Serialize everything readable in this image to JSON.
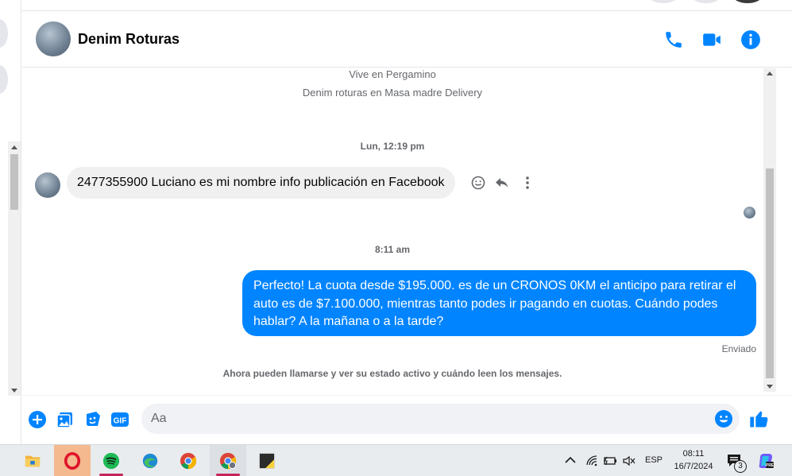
{
  "header": {
    "contact_name": "Denim Roturas"
  },
  "chat": {
    "intro_lines": [
      "Vive en Pergamino",
      "Denim roturas en Masa madre Delivery"
    ],
    "timestamp_1": "Lun, 12:19 pm",
    "incoming_message": "2477355900 Luciano es mi nombre info publicación en Facebook",
    "timestamp_2": "8:11 am",
    "outgoing_message": "Perfecto! La cuota desde $195.000. es de un CRONOS 0KM el anticipo para retirar el auto es de $7.100.000, mientras tanto podes ir pagando en cuotas. Cuándo podes hablar? A la mañana o a la tarde?",
    "sent_status": "Enviado",
    "system_notice": "Ahora pueden llamarse y ver su estado activo y cuándo leen los mensajes."
  },
  "composer": {
    "placeholder": "Aa"
  },
  "taskbar": {
    "language": "ESP",
    "time": "08:11",
    "date": "16/7/2024",
    "notification_count": "3"
  },
  "colors": {
    "accent": "#0084ff",
    "incoming_bubble": "#f0f0f0"
  }
}
